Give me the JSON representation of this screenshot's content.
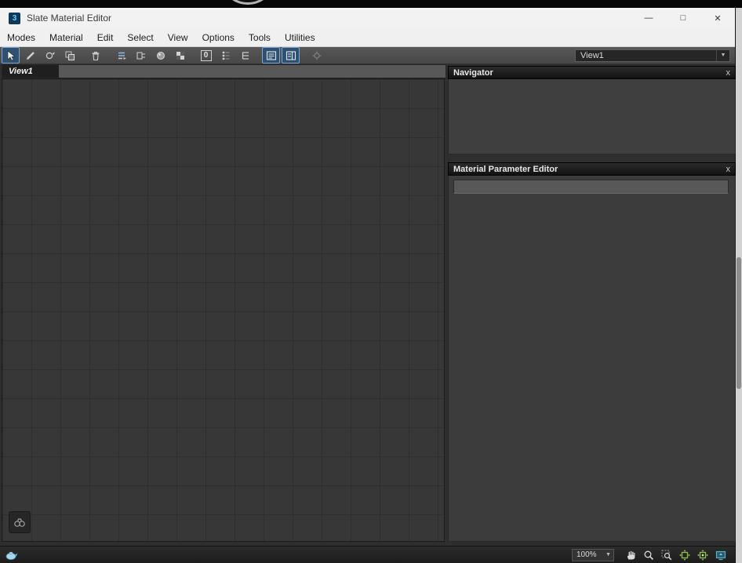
{
  "window": {
    "title": "Slate Material Editor",
    "app_icon_glyph": "3",
    "minimize_glyph": "—",
    "maximize_glyph": "□",
    "close_glyph": "✕"
  },
  "menubar": {
    "items": [
      "Modes",
      "Material",
      "Edit",
      "Select",
      "View",
      "Options",
      "Tools",
      "Utilities"
    ]
  },
  "toolbar": {
    "view_selector_value": "View1",
    "dropdown_arrow_glyph": "▼",
    "show_number_label": "0",
    "icons": [
      "select-tool",
      "pick-material-from-object",
      "put-material-to-scene",
      "assign-material-to-selection",
      "delete-selected",
      "move-children",
      "hide-unused-nodeslots",
      "show-shaded-material-in-viewport",
      "show-background",
      "show-number",
      "layout-all",
      "layout-children",
      "show-material-map-navigator",
      "show-parameter-editor",
      "select-by-material"
    ]
  },
  "view_tab": {
    "label": "View1"
  },
  "navigator_panel": {
    "title": "Navigator",
    "close_glyph": "x"
  },
  "parameter_editor_panel": {
    "title": "Material Parameter Editor",
    "close_glyph": "x",
    "field_value": ""
  },
  "statusbar": {
    "zoom_value": "100%",
    "dropdown_arrow_glyph": "▼",
    "icons": [
      "pan-hand",
      "zoom",
      "zoom-region",
      "zoom-extents",
      "zoom-extents-selected",
      "pan-to-selected"
    ]
  },
  "colors": {
    "toggle_highlight": "#30506f",
    "toggle_border": "#7aa6d8",
    "green_icon": "#8cbf4e",
    "teal_icon": "#4fb0c6",
    "titlebar_bg": "#f2f2f2",
    "canvas_bg": "#373737",
    "panel_header_bg": "#161616"
  }
}
